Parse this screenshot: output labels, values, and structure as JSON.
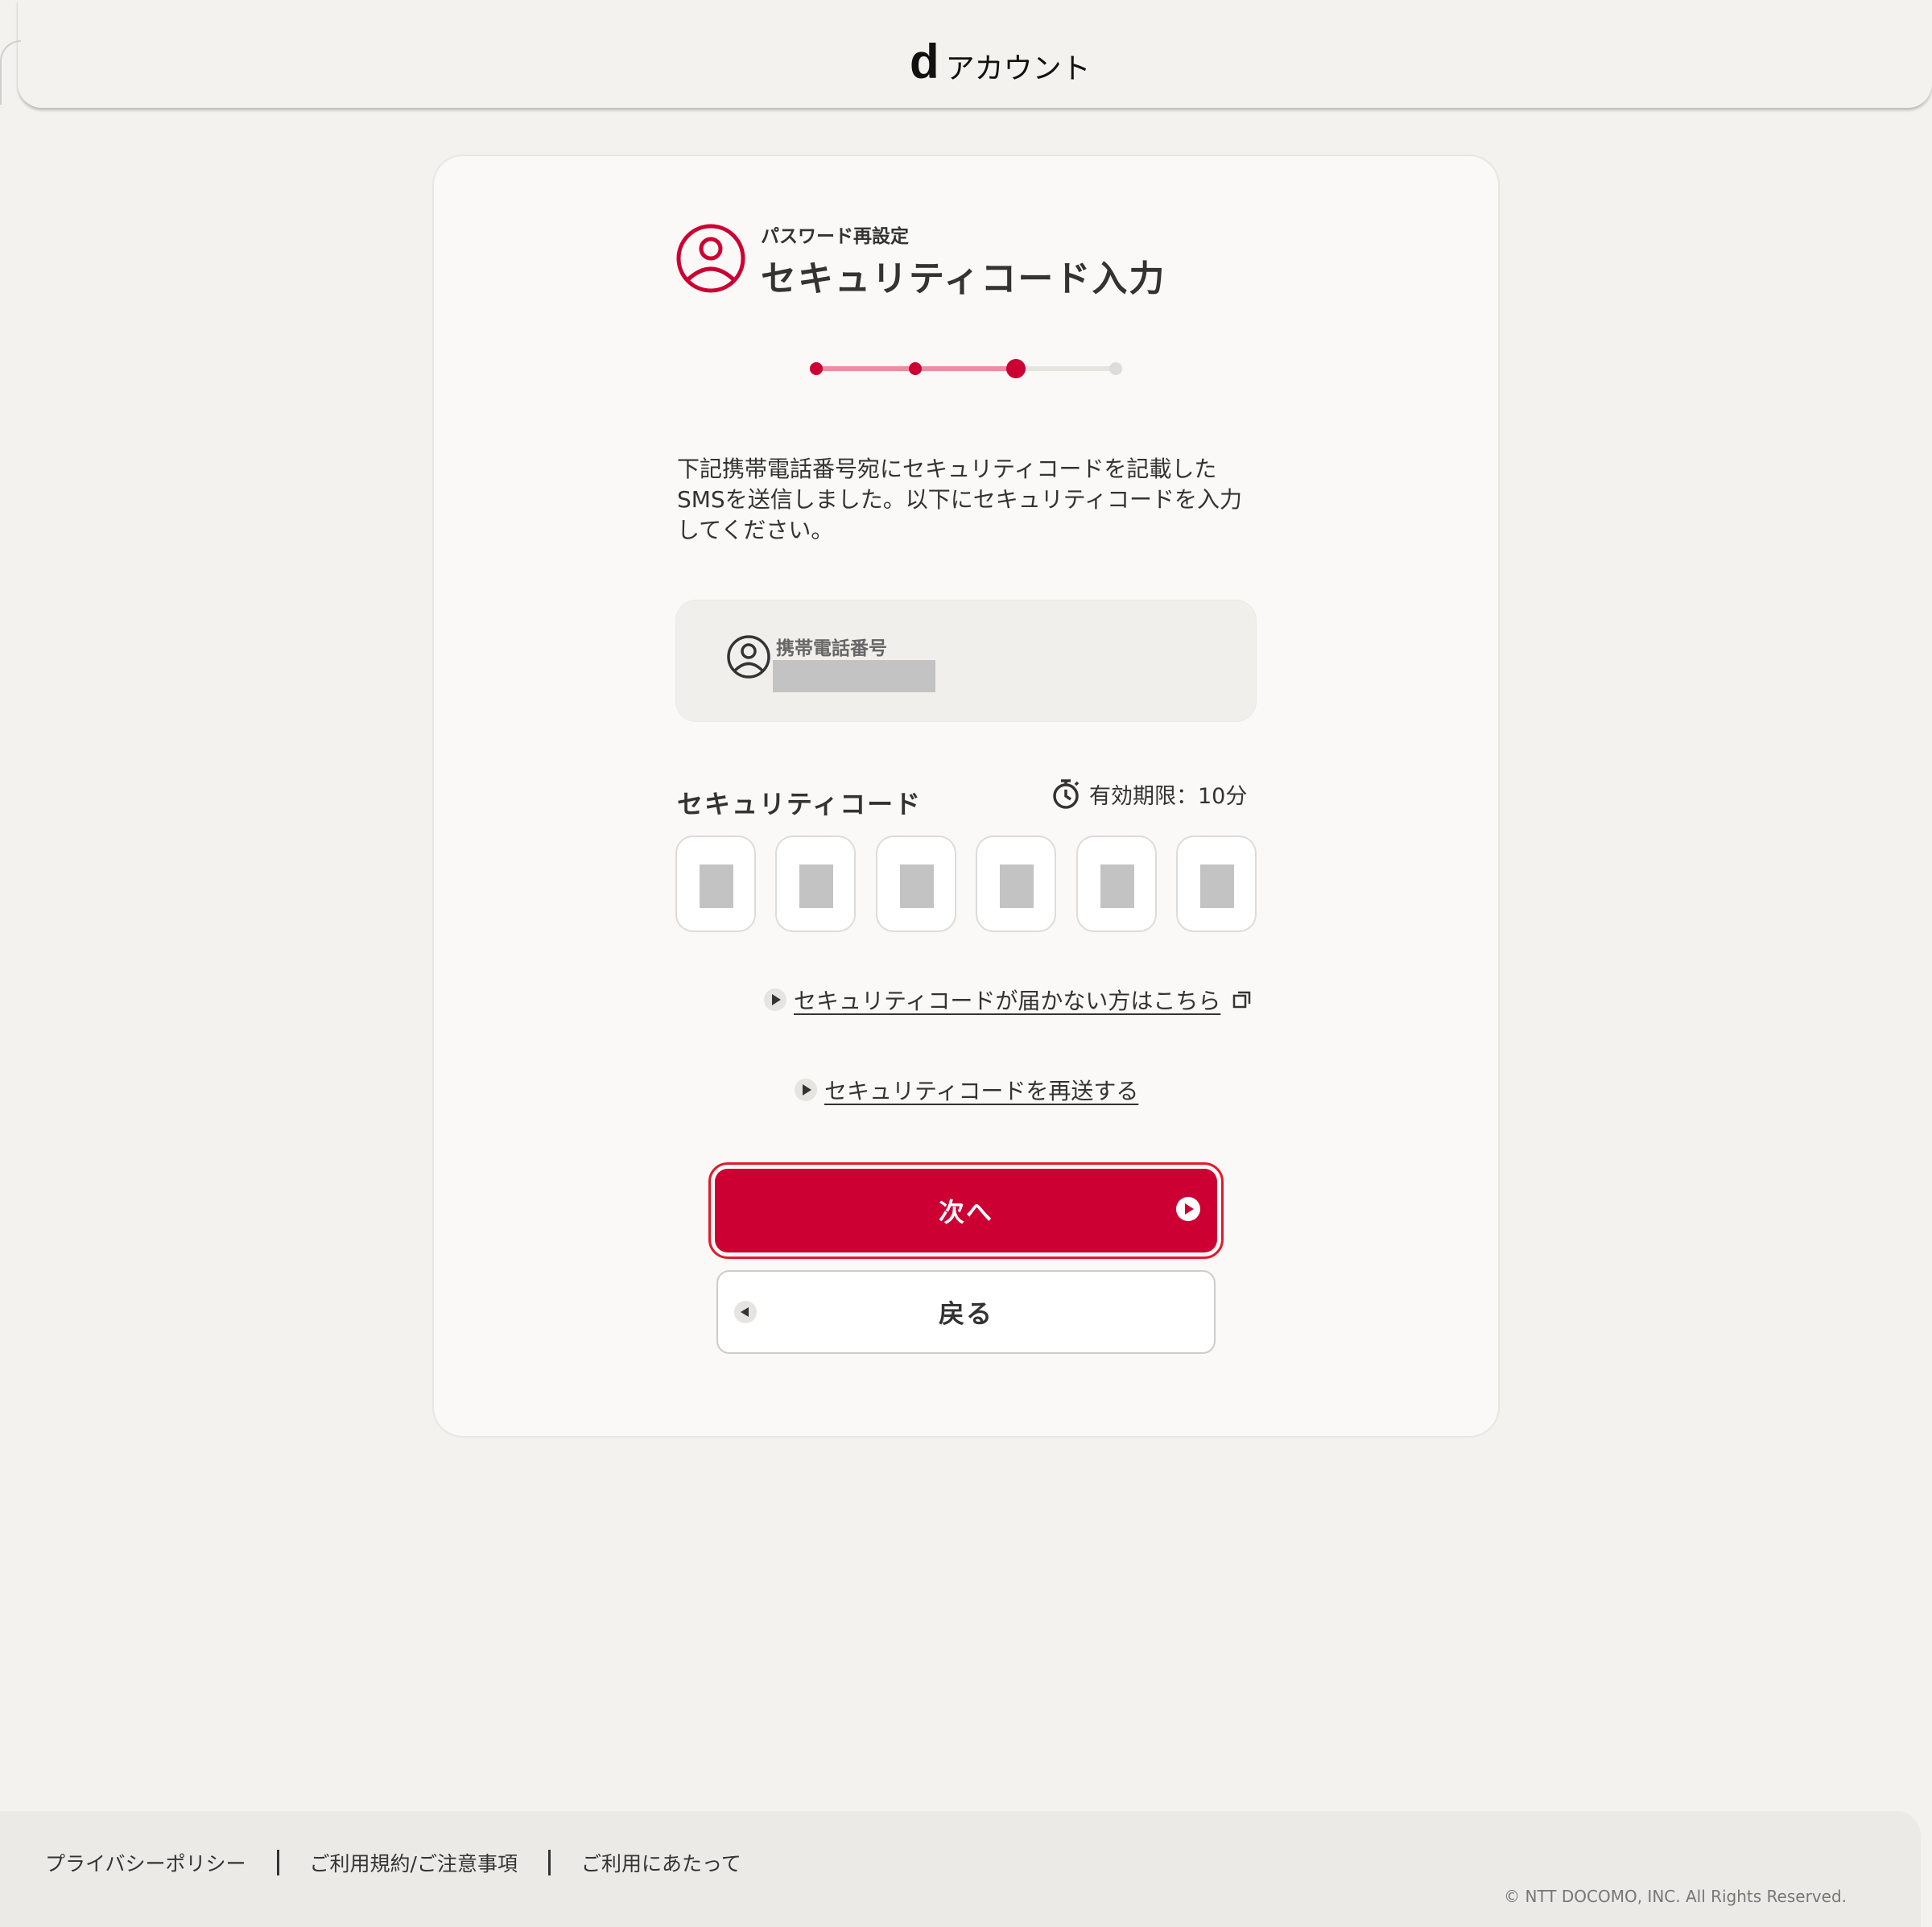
{
  "header": {
    "logo_mark": "d",
    "logo_text": "アカウント"
  },
  "page": {
    "subtitle": "パスワード再設定",
    "title": "セキュリティコード入力",
    "stepper": {
      "total_steps": 4,
      "current_step": 3
    },
    "description": "下記携帯電話番号宛にセキュリティコードを記載したSMSを送信しました。以下にセキュリティコードを入力してください。"
  },
  "phone": {
    "label": "携帯電話番号",
    "icon": "user-circle-icon"
  },
  "security_code": {
    "label": "セキュリティコード",
    "expiry_text": "有効期限：10分",
    "expiry_icon": "stopwatch-icon",
    "digit_count": 6
  },
  "links": {
    "not_received": "セキュリティコードが届かない方はこちら",
    "resend": "セキュリティコードを再送する"
  },
  "buttons": {
    "next": "次へ",
    "back": "戻る"
  },
  "footer": {
    "privacy": "プライバシーポリシー",
    "terms": "ご利用規約/ご注意事項",
    "usage": "ご利用にあたって",
    "copyright": "© NTT DOCOMO, INC. All Rights Reserved."
  },
  "colors": {
    "brand_red": "#cc0033",
    "step_done_line": "#ee8ca0",
    "step_pending": "#dcdcdc"
  }
}
